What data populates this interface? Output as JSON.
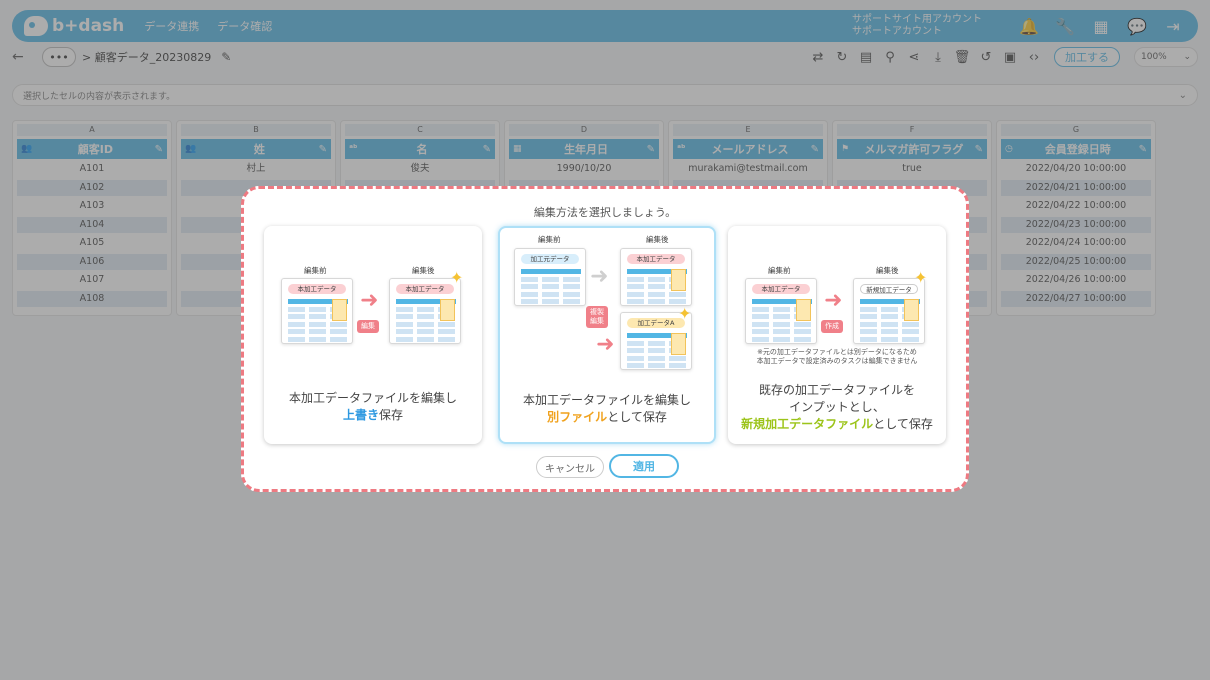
{
  "app": {
    "logo_text": "b+dash"
  },
  "nav": {
    "items": [
      "データ連携",
      "データ確認"
    ]
  },
  "account": {
    "line1": "サポートサイト用アカウント",
    "line2": "サポートアカウント"
  },
  "breadcrumb": {
    "more": "•••",
    "path": "> 顧客データ_20230829"
  },
  "toolbar": {
    "process_label": "加工する",
    "zoom": "100%"
  },
  "cellbar": {
    "placeholder": "選択したセルの内容が表示されます。"
  },
  "sheet": {
    "columns": [
      {
        "letter": "A",
        "name": "顧客ID",
        "icon": "people-icon",
        "cells": [
          "A101",
          "A102",
          "A103",
          "A104",
          "A105",
          "A106",
          "A107",
          "A108"
        ]
      },
      {
        "letter": "B",
        "name": "姓",
        "icon": "people-icon",
        "cells": [
          "村上",
          "",
          "",
          "",
          "",
          "",
          "",
          ""
        ]
      },
      {
        "letter": "C",
        "name": "名",
        "icon": "text-icon",
        "cells": [
          "俊夫",
          "",
          "",
          "",
          "",
          "",
          "",
          ""
        ]
      },
      {
        "letter": "D",
        "name": "生年月日",
        "icon": "calendar-icon",
        "cells": [
          "1990/10/20",
          "",
          "",
          "",
          "",
          "",
          "",
          ""
        ]
      },
      {
        "letter": "E",
        "name": "メールアドレス",
        "icon": "text-icon",
        "cells": [
          "murakami@testmail.com",
          "",
          "",
          "",
          "",
          "",
          "",
          ""
        ]
      },
      {
        "letter": "F",
        "name": "メルマガ許可フラグ",
        "icon": "flag-icon",
        "cells": [
          "true",
          "",
          "",
          "",
          "",
          "",
          "",
          ""
        ]
      },
      {
        "letter": "G",
        "name": "会員登録日時",
        "icon": "clock-icon",
        "cells": [
          "2022/04/20 10:00:00",
          "2022/04/21 10:00:00",
          "2022/04/22 10:00:00",
          "2022/04/23 10:00:00",
          "2022/04/24 10:00:00",
          "2022/04/25 10:00:00",
          "2022/04/26 10:00:00",
          "2022/04/27 10:00:00"
        ]
      }
    ]
  },
  "modal": {
    "title": "編集方法を選択しましょう。",
    "option1": {
      "before": "編集前",
      "after": "編集後",
      "doc": "本加工データ",
      "action": "編集",
      "line1": "本加工データファイルを編集し",
      "hl": "上書き",
      "tail": "保存"
    },
    "option2": {
      "before": "編集前",
      "after": "編集後",
      "src": "加工元データ",
      "doc": "本加工データ",
      "doc2": "加工データA",
      "action1": "複製",
      "action2": "編集",
      "line1": "本加工データファイルを編集し",
      "hl": "別ファイル",
      "tail": "として保存"
    },
    "option3": {
      "before": "編集前",
      "after": "編集後",
      "doc": "本加工データ",
      "doc2": "新規加工データ",
      "action": "作成",
      "note1": "※元の加工データファイルとは別データになるため",
      "note2": "本加工データで設定済みのタスクは編集できません",
      "line1": "既存の加工データファイルを",
      "line2": "インプットとし、",
      "hl": "新規加工データファイル",
      "tail": "として保存"
    },
    "cancel_label": "キャンセル",
    "apply_label": "適用"
  }
}
